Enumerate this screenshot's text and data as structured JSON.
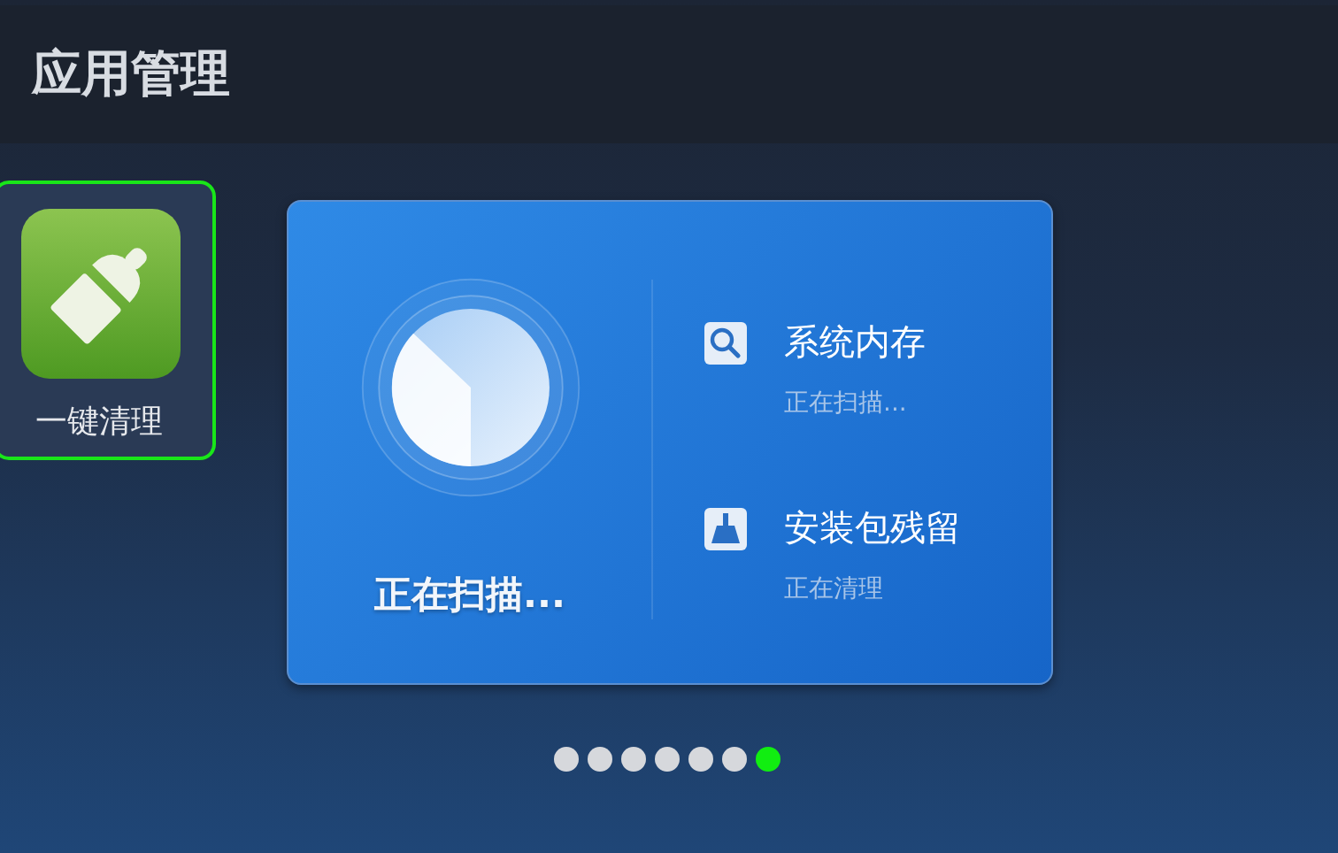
{
  "header": {
    "title": "应用管理"
  },
  "apps": [
    {
      "label": "一键清理",
      "selected": true
    }
  ],
  "scan_card": {
    "status": "正在扫描...",
    "tasks": [
      {
        "kind": "search",
        "title": "系统内存",
        "status": "正在扫描..."
      },
      {
        "kind": "broom",
        "title": "安装包残留",
        "status": "正在清理"
      }
    ]
  },
  "pager": [
    {
      "selected": false
    },
    {
      "selected": false
    },
    {
      "selected": false
    },
    {
      "selected": false
    },
    {
      "selected": false
    },
    {
      "selected": false
    },
    {
      "selected": true
    }
  ]
}
